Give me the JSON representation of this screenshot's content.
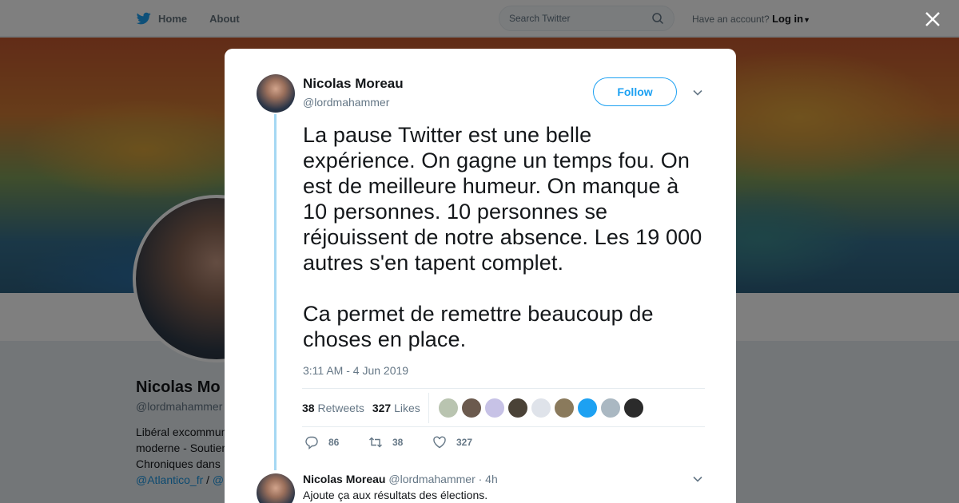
{
  "nav": {
    "home_label": "Home",
    "about_label": "About",
    "search_placeholder": "Search Twitter",
    "account_prompt": "Have an account?",
    "login_label": "Log in"
  },
  "profile_background": {
    "name": "Nicolas Mo",
    "handle": "@lordmahammer",
    "bio_lines": [
      "Libéral excommun",
      "moderne - Soutier",
      "Chroniques dans"
    ],
    "links": [
      "@Atlantico_fr",
      "/",
      "@"
    ]
  },
  "tweet": {
    "author_name": "Nicolas Moreau",
    "author_handle": "@lordmahammer",
    "follow_label": "Follow",
    "text": "La pause Twitter est une belle expérience. On gagne un temps fou. On est de meilleure humeur. On manque à 10 personnes. 10 personnes se réjouissent de notre absence. Les 19 000 autres s'en tapent complet.\n\nCa permet de remettre beaucoup de choses en place.",
    "timestamp": "3:11 AM - 4 Jun 2019",
    "retweets_count": "38",
    "retweets_label": "Retweets",
    "likes_count": "327",
    "likes_label": "Likes",
    "liker_colors": [
      "#b9c4b0",
      "#6b5a4e",
      "#c7c2e6",
      "#4a4237",
      "#dfe3ea",
      "#8a7a5c",
      "#1da1f2",
      "#aab8c2",
      "#2b2b2b"
    ],
    "actions": {
      "reply_count": "86",
      "retweet_count": "38",
      "like_count": "327"
    }
  },
  "reply": {
    "author_name": "Nicolas Moreau",
    "author_handle": "@lordmahammer",
    "time": "· 4h",
    "text": "Ajoute ça aux résultats des élections."
  },
  "colors": {
    "accent": "#1da1f2",
    "thread_line": "#a5d8f3",
    "muted_text": "#657786"
  }
}
